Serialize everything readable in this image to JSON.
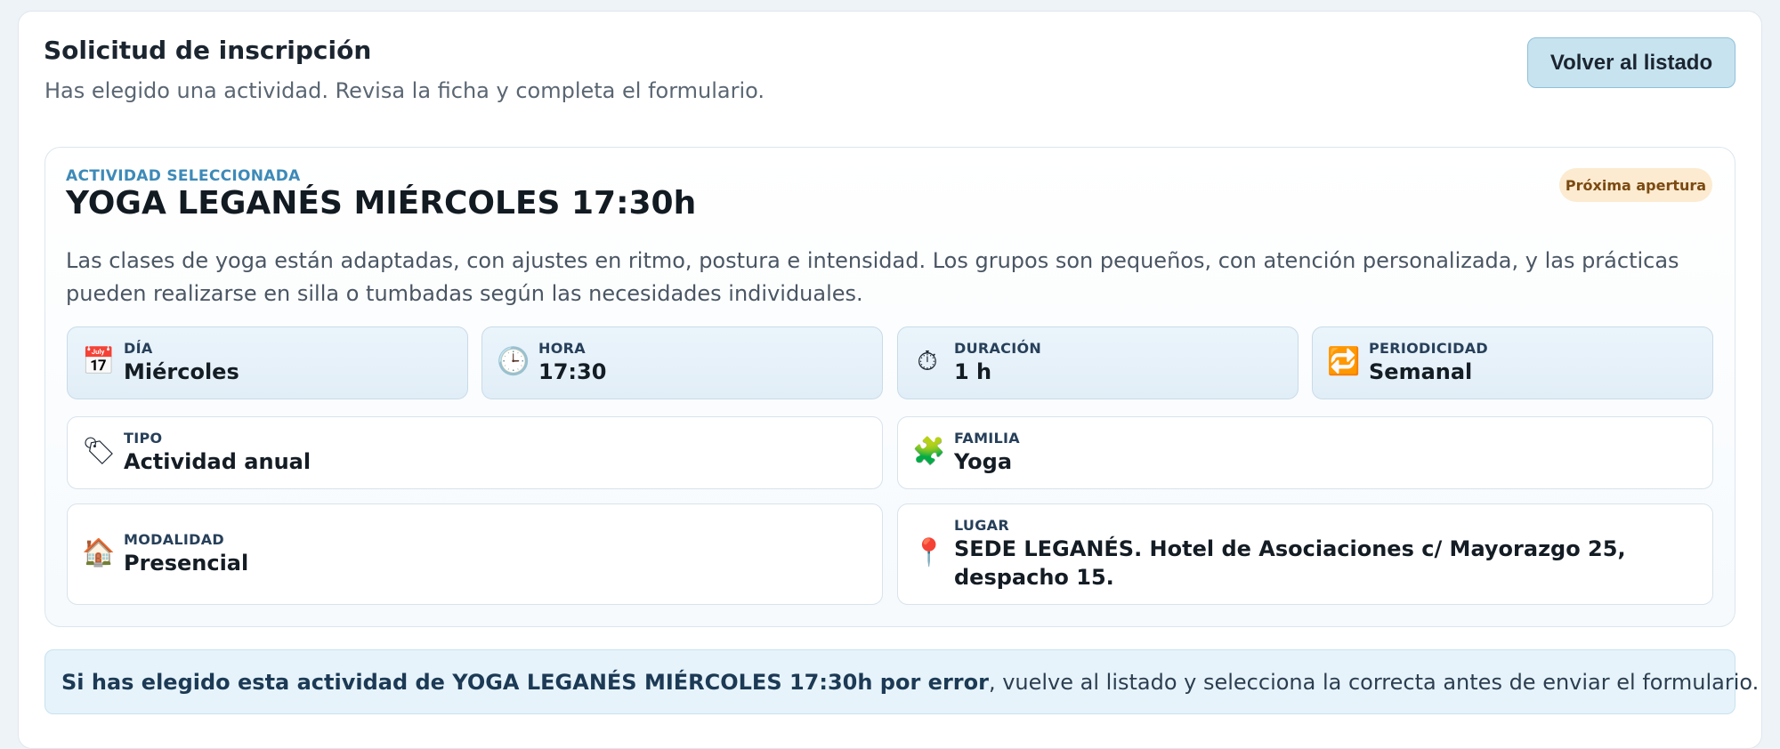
{
  "header": {
    "title": "Solicitud de inscripción",
    "subtitle": "Has elegido una actividad. Revisa la ficha y completa el formulario.",
    "back_button_label": "Volver al listado"
  },
  "activity": {
    "eyebrow": "ACTIVIDAD SELECCIONADA",
    "title": "YOGA LEGANÉS MIÉRCOLES 17:30h",
    "status_badge": "Próxima apertura",
    "description": "Las clases de yoga están adaptadas, con ajustes en ritmo, postura e intensidad. Los grupos son pequeños, con atención personalizada, y las prácticas pueden realizarse en silla o tumbadas según las necesidades individuales.",
    "details": {
      "dia": {
        "label": "DÍA",
        "value": "Miércoles",
        "icon": "calendar-icon",
        "glyph": "📅"
      },
      "hora": {
        "label": "HORA",
        "value": "17:30",
        "icon": "clock-icon",
        "glyph": "🕒"
      },
      "duracion": {
        "label": "DURACIÓN",
        "value": "1 h",
        "icon": "stopwatch-icon",
        "glyph": "⏱"
      },
      "periodicidad": {
        "label": "PERIODICIDAD",
        "value": "Semanal",
        "icon": "repeat-icon",
        "glyph": "🔁"
      },
      "tipo": {
        "label": "TIPO",
        "value": "Actividad anual",
        "icon": "tag-icon",
        "glyph": "🏷"
      },
      "familia": {
        "label": "FAMILIA",
        "value": "Yoga",
        "icon": "puzzle-icon",
        "glyph": "🧩"
      },
      "modalidad": {
        "label": "MODALIDAD",
        "value": "Presencial",
        "icon": "house-icon",
        "glyph": "🏠"
      },
      "lugar": {
        "label": "LUGAR",
        "value": "SEDE LEGANÉS. Hotel de Asociaciones c/ Mayorazgo 25, despacho 15.",
        "icon": "map-pin-icon",
        "glyph": "📍"
      }
    }
  },
  "notice": {
    "strong_text": "Si has elegido esta actividad de YOGA LEGANÉS MIÉRCOLES 17:30h por error",
    "rest_text": ", vuelve al listado y selecciona la correcta antes de enviar el formulario."
  },
  "colors": {
    "accent": "#3d8ab8",
    "button_bg": "#c7e3f0",
    "badge_bg": "#fcebd0",
    "badge_text": "#7a4a12",
    "notice_bg": "#e6f3fa"
  }
}
